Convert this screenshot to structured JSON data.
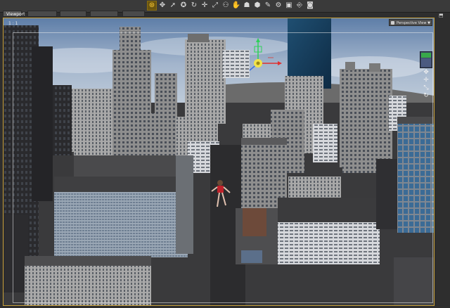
{
  "toolbar": {
    "tools": [
      {
        "name": "universal-tool-icon",
        "glyph": "⊛"
      },
      {
        "name": "translate-tool-icon",
        "glyph": "✥"
      },
      {
        "name": "pointer-tool-icon",
        "glyph": "➚"
      },
      {
        "name": "node-select-icon",
        "glyph": "✪"
      },
      {
        "name": "rotate-tool-icon",
        "glyph": "↻"
      },
      {
        "name": "move-tool-icon",
        "glyph": "✛"
      },
      {
        "name": "scale-tool-icon",
        "glyph": "⤢"
      },
      {
        "name": "joint-editor-icon",
        "glyph": "⚇"
      },
      {
        "name": "pose-tool-icon",
        "glyph": "✋"
      },
      {
        "name": "region-navigator-icon",
        "glyph": "☗"
      },
      {
        "name": "geometry-editor-icon",
        "glyph": "⬢"
      },
      {
        "name": "surface-selection-icon",
        "glyph": "✎"
      },
      {
        "name": "node-weight-icon",
        "glyph": "⚙"
      },
      {
        "name": "render-settings-icon",
        "glyph": "▣"
      },
      {
        "name": "spot-render-icon",
        "glyph": "⎆"
      },
      {
        "name": "camera-icon",
        "glyph": "◙"
      }
    ]
  },
  "tabs": [
    "Viewport",
    "",
    "",
    "",
    ""
  ],
  "viewport": {
    "corner_label": "1 : 1",
    "view_name": "Perspective View"
  },
  "colors": {
    "accent": "#c9a13a",
    "sky": "#8da4bf",
    "gizmo_x": "#e03030",
    "gizmo_y": "#2fd05a",
    "gizmo_center": "#f2e34a",
    "figure_top": "#c0212a"
  }
}
